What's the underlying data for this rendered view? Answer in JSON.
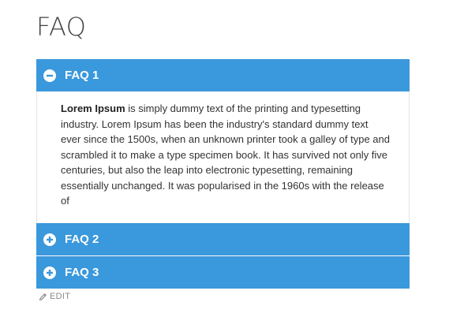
{
  "page": {
    "title": "FAQ"
  },
  "accordion": {
    "items": [
      {
        "label": "FAQ 1",
        "state": "expanded",
        "icon": "minus-circle-icon",
        "body_bold": "Lorem Ipsum",
        "body_text": " is simply dummy text of the printing and typesetting industry. Lorem Ipsum has been the industry's standard dummy text ever since the 1500s, when an unknown printer took a galley of type and scrambled it to make a type specimen book. It has survived not only five centuries, but also the leap into electronic typesetting, remaining essentially unchanged. It was popularised in the 1960s with the release of"
      },
      {
        "label": "FAQ 2",
        "state": "collapsed",
        "icon": "plus-circle-icon"
      },
      {
        "label": "FAQ 3",
        "state": "collapsed",
        "icon": "plus-circle-icon"
      }
    ]
  },
  "edit": {
    "label": "EDIT",
    "icon": "pencil-icon"
  },
  "colors": {
    "accordion_header": "#3a98dc",
    "header_text": "#ffffff",
    "body_text": "#333333",
    "edit_text": "#888888"
  }
}
